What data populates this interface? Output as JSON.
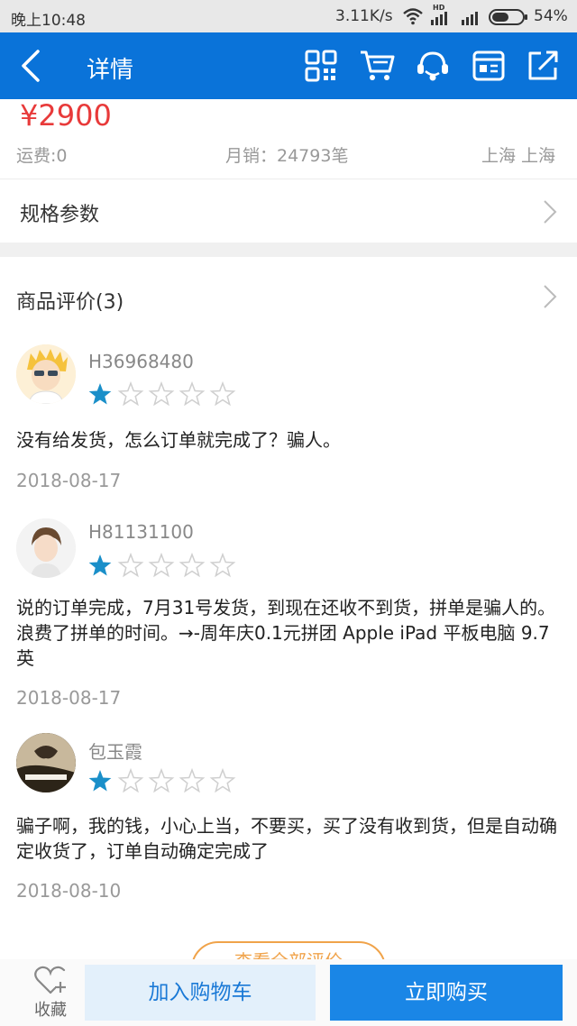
{
  "status_bar": {
    "time": "晚上10:48",
    "network_speed": "3.11K/s",
    "hd_label": "HD",
    "battery": "54%"
  },
  "header": {
    "title": "详情",
    "icons": [
      "back-icon",
      "qrcode-icon",
      "cart-icon",
      "customer-service-icon",
      "message-icon",
      "share-icon"
    ]
  },
  "product": {
    "price": "¥2900",
    "shipping": "运费:0",
    "monthly_sales": "月销：24793笔",
    "location": "上海 上海"
  },
  "specs": {
    "label": "规格参数"
  },
  "reviews": {
    "header": "商品评价(3)",
    "items": [
      {
        "user": "H36968480",
        "rating": 1,
        "text": "没有给发货，怎么订单就完成了？骗人。",
        "date": "2018-08-17"
      },
      {
        "user": "H81131100",
        "rating": 1,
        "text": "说的订单完成，7月31号发货，到现在还收不到货，拼单是骗人的。浪费了拼单的时间。→-周年庆0.1元拼团 Apple iPad 平板电脑 9.7英",
        "date": "2018-08-17"
      },
      {
        "user": "包玉霞",
        "rating": 1,
        "text": "骗子啊，我的钱，小心上当，不要买，买了没有收到货，但是自动确定收货了，订单自动确定完成了",
        "date": "2018-08-10"
      }
    ],
    "view_all": "查看全部评价"
  },
  "bottom_bar": {
    "favorite": "收藏",
    "add_to_cart": "加入购物车",
    "buy_now": "立即购买"
  },
  "colors": {
    "header": "#0a73d9",
    "price": "#e83a3a",
    "star": "#1a8fc9",
    "buy": "#1a86e6"
  }
}
